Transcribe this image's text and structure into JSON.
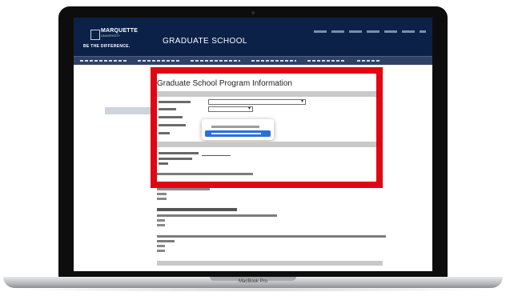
{
  "device": {
    "model_label": "MacBook Pro"
  },
  "site": {
    "logo_name": "MARQUETTE",
    "logo_sub": "UNIVERSITY",
    "tagline": "BE THE DIFFERENCE.",
    "section_title": "GRADUATE SCHOOL"
  },
  "sidebar": {
    "items": [
      {
        "label": ""
      },
      {
        "label": ""
      },
      {
        "label": ""
      },
      {
        "label": ""
      },
      {
        "label": ""
      },
      {
        "label": ""
      },
      {
        "label": ""
      },
      {
        "label": ""
      },
      {
        "label": ""
      },
      {
        "label": ""
      },
      {
        "label": ""
      },
      {
        "label": ""
      },
      {
        "label": ""
      },
      {
        "label": ""
      }
    ]
  },
  "form": {
    "title": "Graduate School Program Information"
  },
  "colors": {
    "header_bg": "#0b2148",
    "nav_bg": "#2f4165",
    "highlight_frame": "#e10613",
    "popup_selected": "#2d6fd8",
    "link": "#1a3fcf"
  }
}
